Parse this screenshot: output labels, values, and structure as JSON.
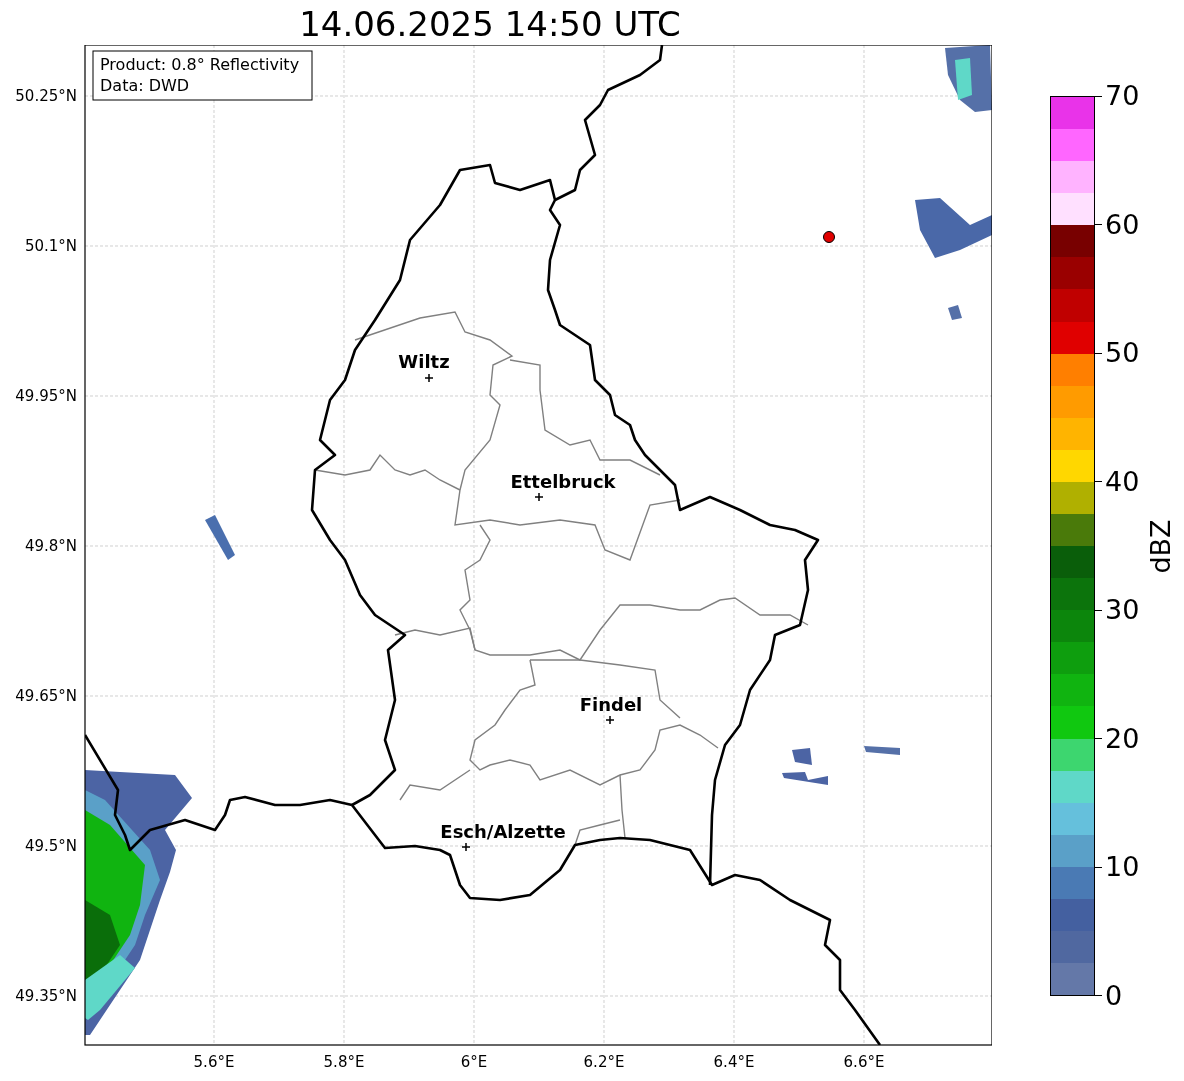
{
  "title": "14.06.2025 14:50 UTC",
  "info_box": {
    "lines": [
      "Product: 0.8° Reflectivity",
      "Data: DWD"
    ]
  },
  "map": {
    "y_ticks": [
      "50.25°N",
      "50.1°N",
      "49.95°N",
      "49.8°N",
      "49.65°N",
      "49.5°N",
      "49.35°N"
    ],
    "x_ticks": [
      "5.6°E",
      "5.8°E",
      "6°E",
      "6.2°E",
      "6.4°E",
      "6.6°E"
    ],
    "cities": [
      {
        "name": "Wiltz"
      },
      {
        "name": "Ettelbruck"
      },
      {
        "name": "Findel"
      },
      {
        "name": "Esch/Alzette"
      }
    ]
  },
  "colorbar": {
    "label": "dBZ",
    "ticks": [
      "70",
      "60",
      "50",
      "40",
      "30",
      "20",
      "10",
      "0"
    ],
    "segments": [
      {
        "color": "#e933e9"
      },
      {
        "color": "#ff66ff"
      },
      {
        "color": "#ffb3ff"
      },
      {
        "color": "#ffe0ff"
      },
      {
        "color": "#780000"
      },
      {
        "color": "#9a0000"
      },
      {
        "color": "#c00000"
      },
      {
        "color": "#e00000"
      },
      {
        "color": "#ff7f00"
      },
      {
        "color": "#ff9b00"
      },
      {
        "color": "#ffb400"
      },
      {
        "color": "#ffd700"
      },
      {
        "color": "#b0b000"
      },
      {
        "color": "#4a7a0a"
      },
      {
        "color": "#0a5e0a"
      },
      {
        "color": "#0c740c"
      },
      {
        "color": "#0c860c"
      },
      {
        "color": "#0e9e0e"
      },
      {
        "color": "#10b410"
      },
      {
        "color": "#10c810"
      },
      {
        "color": "#3dd66f"
      },
      {
        "color": "#5fd8c8"
      },
      {
        "color": "#65c0dc"
      },
      {
        "color": "#5aa0c8"
      },
      {
        "color": "#4a7ab4"
      },
      {
        "color": "#4460a0"
      },
      {
        "color": "#5068a0"
      },
      {
        "color": "#6478a8"
      }
    ]
  }
}
